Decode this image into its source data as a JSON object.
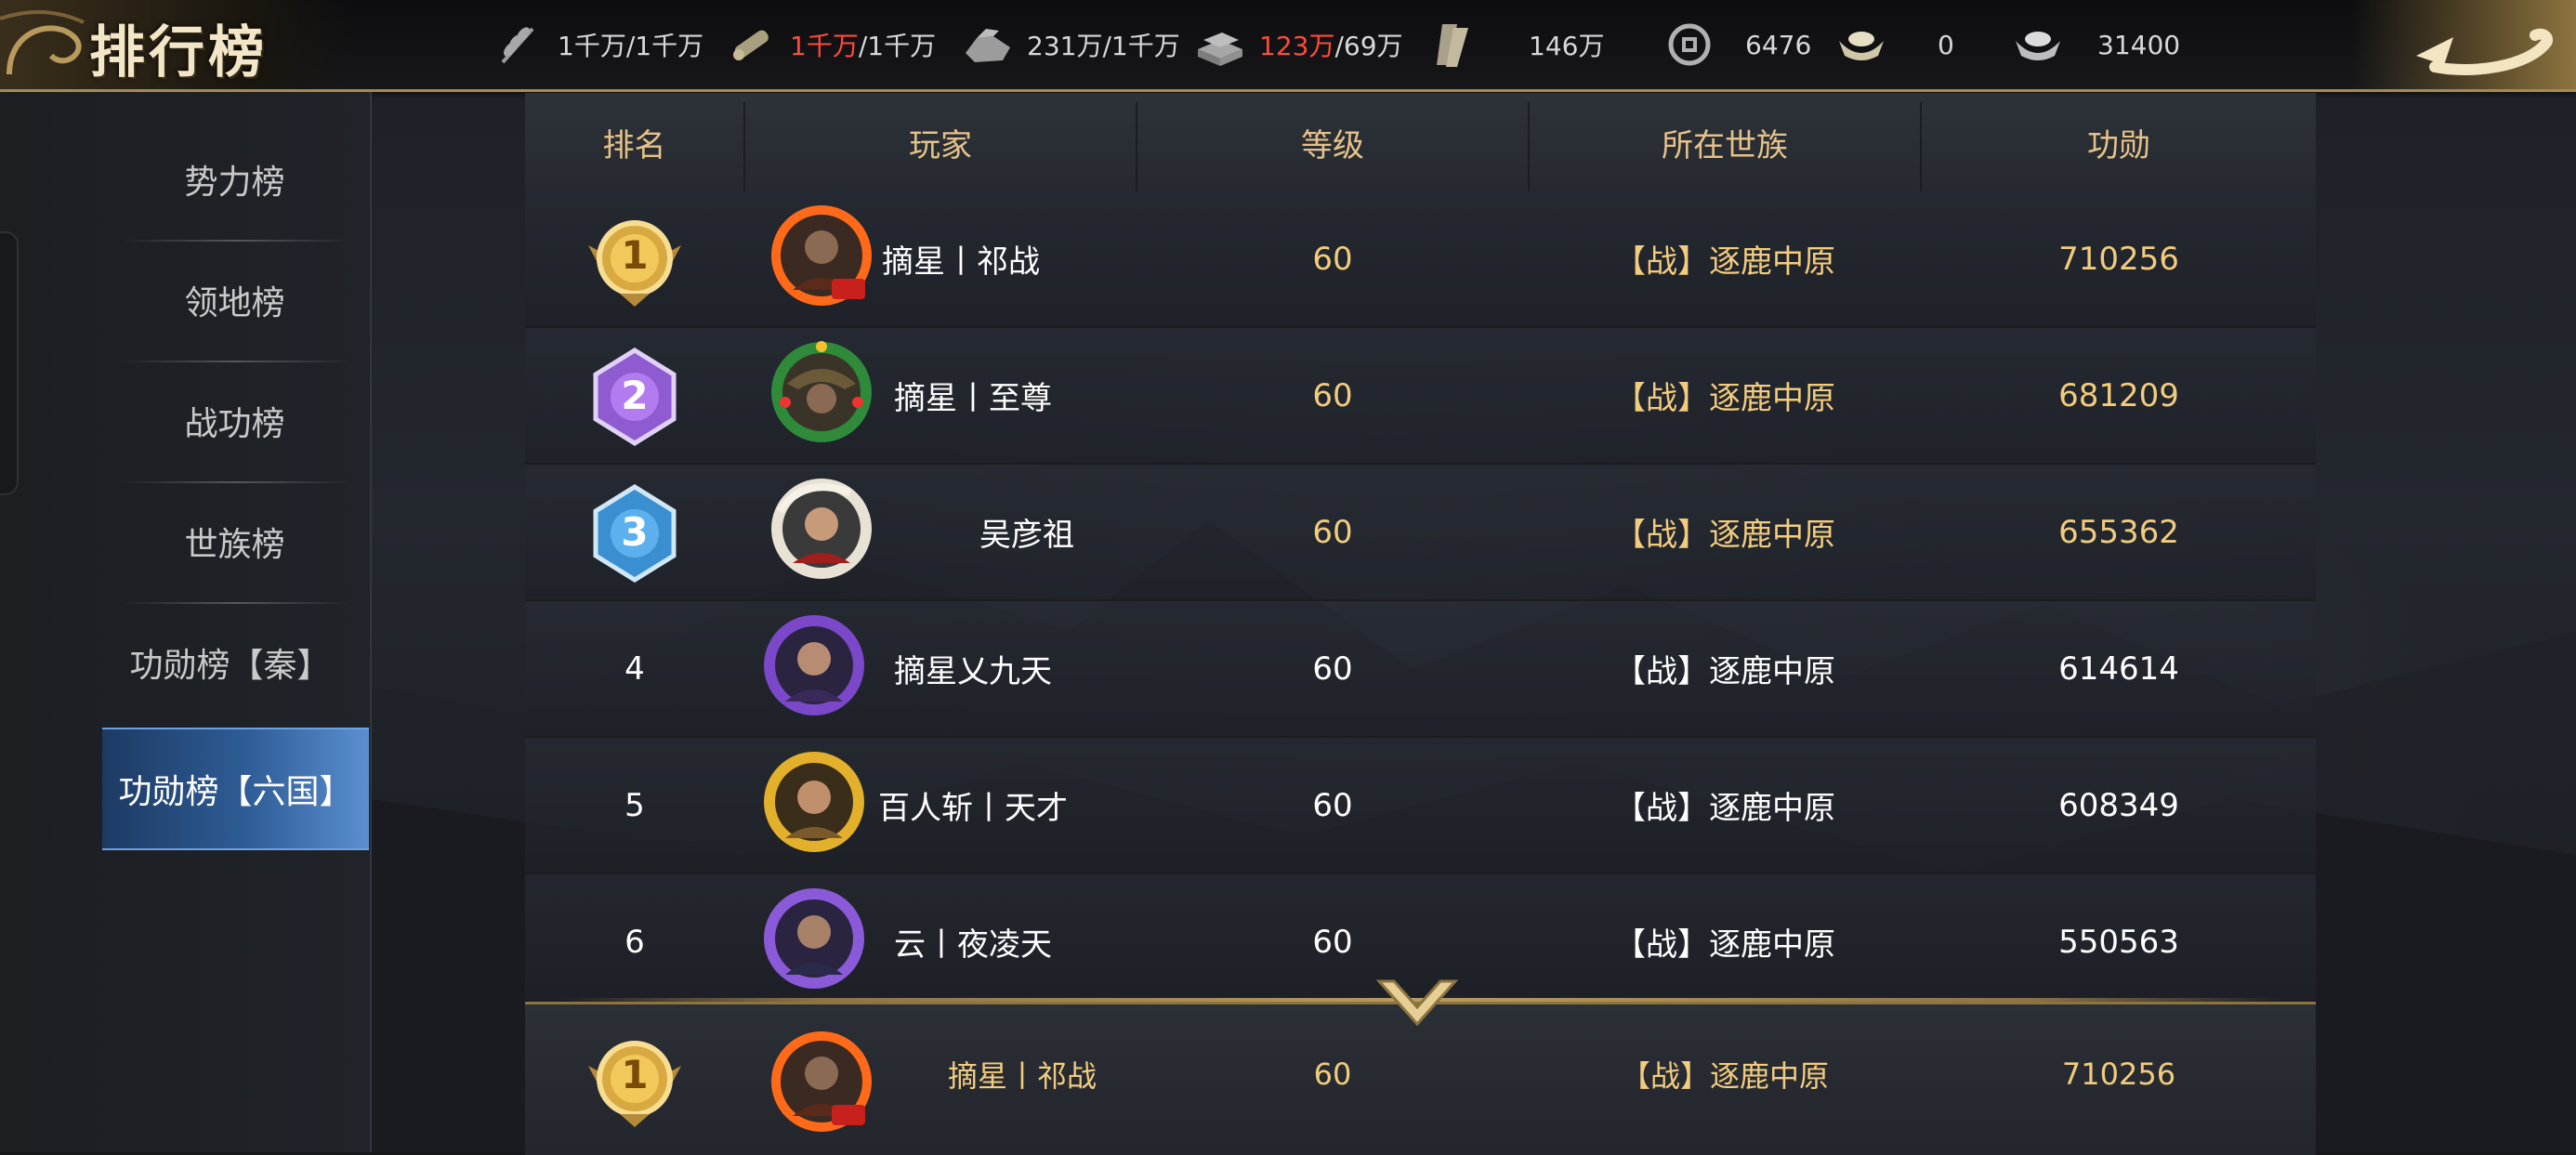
{
  "header": {
    "title": "排行榜",
    "resources": [
      {
        "icon": "grain-icon",
        "parts": [
          {
            "text": "1千万/1千万",
            "red": false
          }
        ]
      },
      {
        "icon": "wood-icon",
        "parts": [
          {
            "text": "1千万",
            "red": true
          },
          {
            "text": "/1千万",
            "red": false
          }
        ]
      },
      {
        "icon": "stone-icon",
        "parts": [
          {
            "text": "231万/1千万",
            "red": false
          }
        ]
      },
      {
        "icon": "iron-icon",
        "parts": [
          {
            "text": "123万",
            "red": true
          },
          {
            "text": "/69万",
            "red": false
          }
        ]
      },
      {
        "icon": "scroll-icon",
        "parts": [
          {
            "text": "146万",
            "red": false
          }
        ]
      },
      {
        "icon": "coin-icon",
        "parts": [
          {
            "text": "6476",
            "red": false
          }
        ]
      },
      {
        "icon": "gold-ingot-icon",
        "parts": [
          {
            "text": "0",
            "red": false
          }
        ]
      },
      {
        "icon": "silver-ingot-icon",
        "parts": [
          {
            "text": "31400",
            "red": false
          }
        ]
      }
    ]
  },
  "sidebar": {
    "items": [
      {
        "label": "势力榜",
        "active": false
      },
      {
        "label": "领地榜",
        "active": false
      },
      {
        "label": "战功榜",
        "active": false
      },
      {
        "label": "世族榜",
        "active": false
      },
      {
        "label": "功勋榜【秦】",
        "active": false
      },
      {
        "label": "功勋榜【六国】",
        "active": true
      }
    ]
  },
  "table": {
    "columns": [
      "排名",
      "玩家",
      "等级",
      "所在世族",
      "功勋"
    ],
    "rows": [
      {
        "rank": "1",
        "medal": "gold",
        "name": "摘星丨祁战",
        "level": "60",
        "clan": "【战】逐鹿中原",
        "merit": "710256",
        "avatar": "red-fire-frame-avatar"
      },
      {
        "rank": "2",
        "medal": "purple",
        "name": "摘星丨至尊",
        "level": "60",
        "clan": "【战】逐鹿中原",
        "merit": "681209",
        "avatar": "wreath-frame-avatar"
      },
      {
        "rank": "3",
        "medal": "blue",
        "name": "吴彦祖",
        "level": "60",
        "clan": "【战】逐鹿中原",
        "merit": "655362",
        "avatar": "white-snake-frame-avatar"
      },
      {
        "rank": "4",
        "medal": "",
        "name": "摘星乂九天",
        "level": "60",
        "clan": "【战】逐鹿中原",
        "merit": "614614",
        "avatar": "purple-flame-frame-avatar"
      },
      {
        "rank": "5",
        "medal": "",
        "name": "百人斩丨天才",
        "level": "60",
        "clan": "【战】逐鹿中原",
        "merit": "608349",
        "avatar": "gold-frame-avatar"
      },
      {
        "rank": "6",
        "medal": "",
        "name": "云丨夜凌天",
        "level": "60",
        "clan": "【战】逐鹿中原",
        "merit": "550563",
        "avatar": "purple-flame-frame-avatar"
      }
    ],
    "self_row": {
      "rank": "1",
      "medal": "gold",
      "name": "摘星丨祁战",
      "level": "60",
      "clan": "【战】逐鹿中原",
      "merit": "710256",
      "avatar": "red-fire-frame-avatar"
    }
  },
  "colors": {
    "header_gold": "#e6c28a",
    "merit_gold": "#f2cc7e",
    "red_value": "#ff4a3a",
    "active_tab": "#2f5d97"
  }
}
